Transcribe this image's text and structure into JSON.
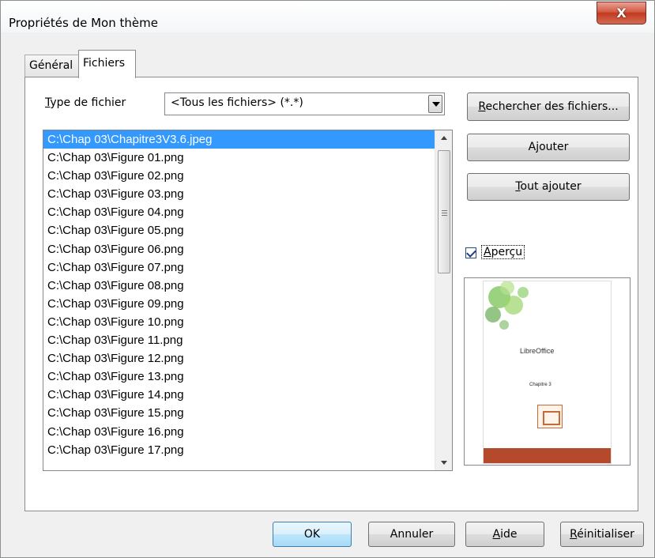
{
  "window": {
    "title": "Propriétés de Mon thème",
    "close_label": "X"
  },
  "tabs": [
    {
      "label": "Général",
      "active": false
    },
    {
      "label": "Fichiers",
      "active": true
    }
  ],
  "filetype": {
    "label": "Type de fichier",
    "value": "<Tous les fichiers> (*.*)"
  },
  "buttons": {
    "search": "Rechercher des fichiers...",
    "add": "Ajouter",
    "add_all": "Tout ajouter",
    "ok": "OK",
    "cancel": "Annuler",
    "help": "Aide",
    "reset": "Réinitialiser"
  },
  "files": [
    "C:\\Chap 03\\Chapitre3V3.6.jpeg",
    "C:\\Chap 03\\Figure 01.png",
    "C:\\Chap 03\\Figure 02.png",
    "C:\\Chap 03\\Figure 03.png",
    "C:\\Chap 03\\Figure 04.png",
    "C:\\Chap 03\\Figure 05.png",
    "C:\\Chap 03\\Figure 06.png",
    "C:\\Chap 03\\Figure 07.png",
    "C:\\Chap 03\\Figure 08.png",
    "C:\\Chap 03\\Figure 09.png",
    "C:\\Chap 03\\Figure 10.png",
    "C:\\Chap 03\\Figure 11.png",
    "C:\\Chap 03\\Figure 12.png",
    "C:\\Chap 03\\Figure 13.png",
    "C:\\Chap 03\\Figure 14.png",
    "C:\\Chap 03\\Figure 15.png",
    "C:\\Chap 03\\Figure 16.png",
    "C:\\Chap 03\\Figure 17.png"
  ],
  "selected_index": 0,
  "preview": {
    "label": "Aperçu",
    "checked": true,
    "thumbnail": {
      "logo_text": "LibreOffice",
      "chapter_text": "Chapitre 3"
    }
  },
  "colors": {
    "selection": "#3399ff",
    "close_button": "#c2391f",
    "thumbnail_band": "#b4492b"
  }
}
